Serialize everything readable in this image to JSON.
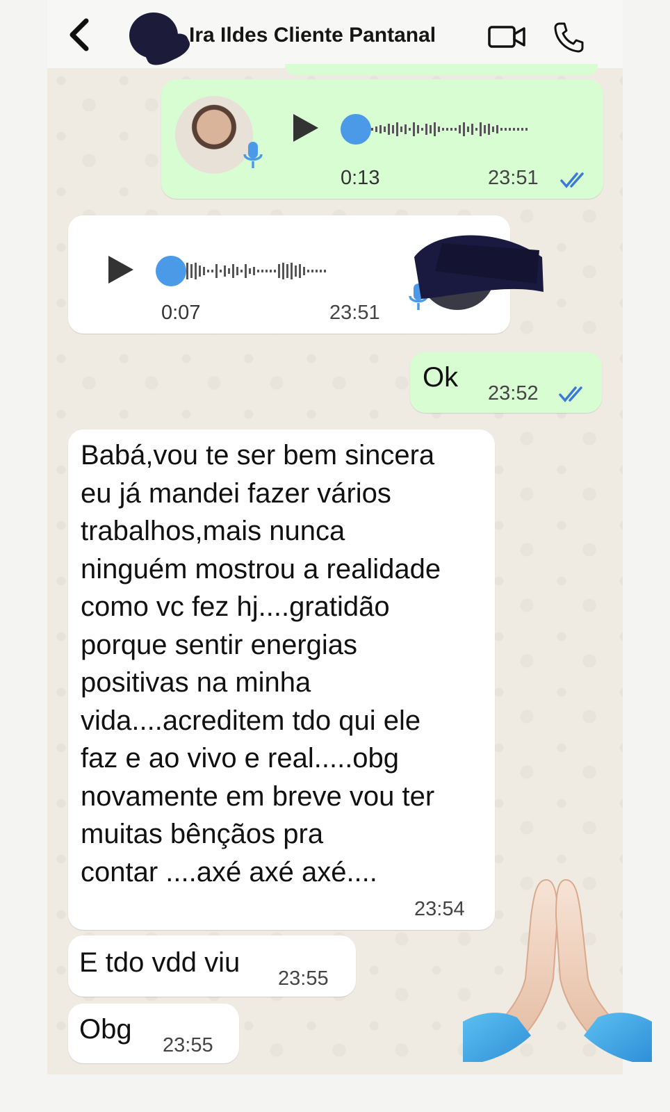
{
  "header": {
    "contact_name": "Ira Ildes Cliente Pantanal",
    "back_icon": "chevron-left-icon",
    "video_icon": "video-camera-icon",
    "call_icon": "phone-icon"
  },
  "messages": [
    {
      "type": "voice",
      "direction": "outgoing",
      "duration": "0:13",
      "time": "23:51",
      "status": "read"
    },
    {
      "type": "voice",
      "direction": "incoming",
      "duration": "0:07",
      "time": "23:51"
    },
    {
      "type": "text",
      "direction": "outgoing",
      "text": "Ok",
      "time": "23:52",
      "status": "read"
    },
    {
      "type": "text",
      "direction": "incoming",
      "text": "Babá,vou te ser bem sincera\neu já mandei fazer vários\ntrabalhos,mais nunca\nninguém mostrou a realidade\ncomo vc fez hj....gratidão\nporque sentir energias\npositivas na minha\nvida....acreditem tdo qui ele\nfaz e ao vivo e real.....obg\nnovamente em breve vou ter\nmuitas bênçãos pra\ncontar ....axé axé axé....",
      "time": "23:54"
    },
    {
      "type": "text",
      "direction": "incoming",
      "text": "E tdo vdd viu",
      "time": "23:55"
    },
    {
      "type": "text",
      "direction": "incoming",
      "text": "Obg",
      "time": "23:55"
    }
  ],
  "colors": {
    "outgoing_bubble": "#d9fdd3",
    "incoming_bubble": "#ffffff",
    "chat_background": "#efeae2",
    "read_ticks": "#3b7ad8",
    "voice_dot": "#4a9ae8"
  },
  "decoration": {
    "emoji": "folded-hands-icon"
  }
}
